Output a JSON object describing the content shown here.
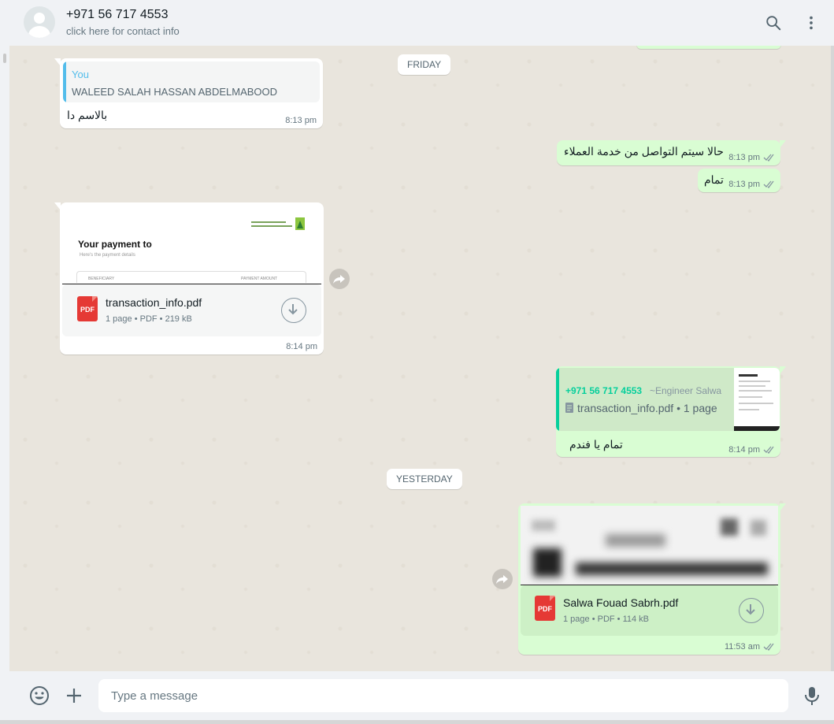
{
  "header": {
    "contact_name": "+971 56 717 4553",
    "contact_sub": "click here for contact info",
    "icons": [
      "avatar",
      "search-icon",
      "menu-icon"
    ]
  },
  "dates": {
    "friday": "FRIDAY",
    "yesterday": "YESTERDAY"
  },
  "messages": {
    "m1": {
      "quote_author": "You",
      "quote_text": "WALEED SALAH HASSAN ABDELMABOOD",
      "text": "بالاسم دا",
      "time": "8:13 pm"
    },
    "m2": {
      "text": "حالا سيتم التواصل من خدمة العملاء",
      "time": "8:13 pm"
    },
    "m3": {
      "text": "تمام",
      "time": "8:13 pm"
    },
    "m4": {
      "preview_title": "Your payment to",
      "preview_sub": "Here's the payment details",
      "preview_col1": "BENEFICIARY",
      "preview_col2": "PAYMENT AMOUNT",
      "filename": "transaction_info.pdf",
      "meta": "1 page • PDF • 219 kB",
      "badge": "PDF",
      "time": "8:14 pm"
    },
    "m5": {
      "quote_author": "+971 56 717 4553",
      "quote_alias": "~Engineer Salwa",
      "quote_file": "transaction_info.pdf • 1 page",
      "text": "تمام يا فندم",
      "time": "8:14 pm"
    },
    "m6": {
      "filename": "Salwa Fouad Sabrh.pdf",
      "meta": "1 page • PDF • 114 kB",
      "badge": "PDF",
      "time": "11:53 am"
    }
  },
  "footer": {
    "placeholder": "Type a message"
  },
  "colors": {
    "outgoing": "#d9fdd3",
    "incoming": "#ffffff",
    "accent_blue": "#53bdeb",
    "accent_green": "#06cf9c",
    "wallpaper": "#e9e5dd"
  }
}
